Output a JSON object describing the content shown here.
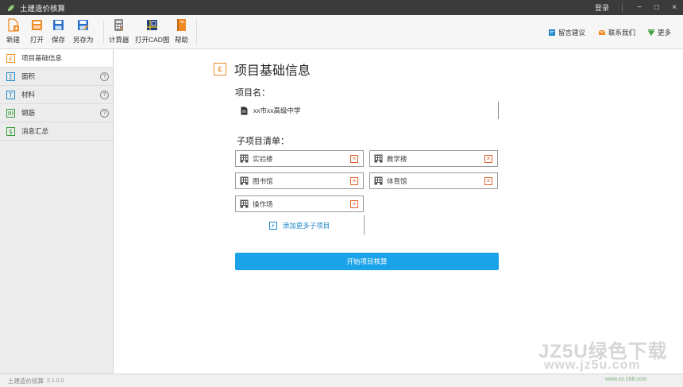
{
  "titlebar": {
    "title": "土建造价核算",
    "login": "登录",
    "minimize": "−",
    "restore": "□",
    "close": "×"
  },
  "toolbar": {
    "items": [
      {
        "label": "新建",
        "icon": "new-file-icon",
        "color": "#f08a24"
      },
      {
        "label": "打开",
        "icon": "open-folder-icon",
        "color": "#f08a24"
      },
      {
        "label": "保存",
        "icon": "save-icon",
        "color": "#2a6fc9"
      },
      {
        "label": "另存为",
        "icon": "save-as-icon",
        "color": "#2a6fc9"
      },
      {
        "label": "计算器",
        "icon": "calculator-icon",
        "color": "#777777"
      },
      {
        "label": "打开CAD图",
        "icon": "cad-icon",
        "color": "#1e3c78"
      },
      {
        "label": "帮助",
        "icon": "help-book-icon",
        "color": "#f08a24"
      }
    ],
    "right": [
      {
        "label": "留言建议",
        "icon": "message-icon",
        "color": "#1e88c8"
      },
      {
        "label": "联系我们",
        "icon": "contact-icon",
        "color": "#f08a24"
      },
      {
        "label": "更多",
        "icon": "more-icon",
        "color": "#3aa03a"
      }
    ]
  },
  "sidebar": {
    "items": [
      {
        "label": "项目基础信息",
        "icon": "info-icon",
        "has_help": false,
        "active": true
      },
      {
        "label": "面积",
        "icon": "area-icon",
        "has_help": true,
        "active": false
      },
      {
        "label": "材料",
        "icon": "material-icon",
        "has_help": true,
        "active": false
      },
      {
        "label": "钢筋",
        "icon": "rebar-icon",
        "has_help": true,
        "active": false
      },
      {
        "label": "消息汇总",
        "icon": "summary-icon",
        "has_help": false,
        "active": false
      }
    ],
    "help_glyph": "?"
  },
  "main": {
    "section_title": "项目基础信息",
    "section_icon": "£",
    "project_name_label": "项目名：",
    "project_name_value": "xx市xx高级中学",
    "project_list_label": "子项目清单：",
    "project_items": [
      "实验楼",
      "教学楼",
      "图书馆",
      "体育馆",
      "操作场"
    ],
    "close_glyph": "×",
    "add_label": "添加更多子项目",
    "add_glyph": "+",
    "start_button": "开始项目核算"
  },
  "statusbar": {
    "text": "土建造价核算",
    "version": "2.1.0.0"
  },
  "watermark": {
    "line1": "JZ5U绿色下载",
    "line2": "www.jz5u.com",
    "line3": "www.xx.188.com"
  },
  "colors": {
    "accent_orange": "#f08a24",
    "accent_blue": "#1aa3e8",
    "link_blue": "#1e88c8",
    "close_red": "#e0622a"
  }
}
